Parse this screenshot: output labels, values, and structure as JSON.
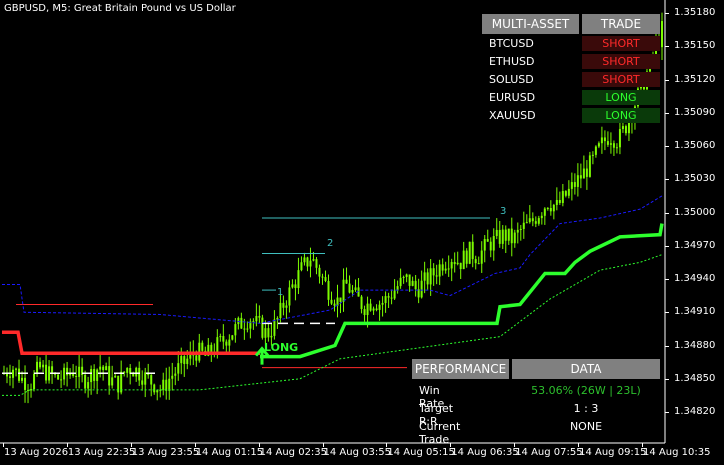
{
  "chart": {
    "title": "GBPUSD, M5:  Great Britain Pound vs US Dollar",
    "signal_label": "LONG",
    "tp_level_labels": [
      "1",
      "2",
      "3"
    ]
  },
  "chart_data": {
    "type": "candlestick",
    "symbol": "GBPUSD",
    "timeframe": "M5",
    "y_ticks": [
      "1.35180",
      "1.35150",
      "1.35120",
      "1.35090",
      "1.35060",
      "1.35030",
      "1.35000",
      "1.34970",
      "1.34940",
      "1.34910",
      "1.34880",
      "1.34850",
      "1.34820"
    ],
    "x_ticks": [
      "13 Aug 2026",
      "13 Aug 22:35",
      "13 Aug 23:55",
      "14 Aug 01:15",
      "14 Aug 02:35",
      "14 Aug 03:55",
      "14 Aug 05:15",
      "14 Aug 06:35",
      "14 Aug 07:55",
      "14 Aug 09:15",
      "14 Aug 10:35"
    ],
    "ylim": [
      1.348,
      1.3519
    ],
    "close_path": [
      1.34855,
      1.3486,
      1.3485,
      1.34845,
      1.3486,
      1.34855,
      1.3485,
      1.34852,
      1.34858,
      1.34848,
      1.34855,
      1.34862,
      1.3485,
      1.34845,
      1.3486,
      1.34858,
      1.34852,
      1.34846,
      1.3484,
      1.34852,
      1.3486,
      1.34868,
      1.34875,
      1.3487,
      1.34878,
      1.34885,
      1.34892,
      1.349,
      1.34905,
      1.34898,
      1.3489,
      1.349,
      1.3492,
      1.34935,
      1.3495,
      1.3496,
      1.34945,
      1.3493,
      1.3492,
      1.34935,
      1.34925,
      1.34915,
      1.3492,
      1.34918,
      1.34925,
      1.34935,
      1.3494,
      1.3493,
      1.34938,
      1.34945,
      1.34955,
      1.3496,
      1.34955,
      1.34965,
      1.3496,
      1.3497,
      1.34975,
      1.3498,
      1.34975,
      1.34985,
      1.3499,
      1.35,
      1.3501,
      1.35005,
      1.35015,
      1.35025,
      1.35035,
      1.35045,
      1.3506,
      1.3507,
      1.35065,
      1.3508,
      1.351,
      1.3512,
      1.3514,
      1.35165
    ],
    "indicator_levels": {
      "entry": 1.349,
      "stop": 1.34868,
      "tp1": 1.3493,
      "tp2": 1.34963,
      "tp3": 1.34995
    }
  },
  "multi_asset": {
    "header_left": "MULTI-ASSET",
    "header_right": "TRADE",
    "rows": [
      {
        "symbol": "BTCUSD",
        "signal": "SHORT"
      },
      {
        "symbol": "ETHUSD",
        "signal": "SHORT"
      },
      {
        "symbol": "SOLUSD",
        "signal": "SHORT"
      },
      {
        "symbol": "EURUSD",
        "signal": "LONG"
      },
      {
        "symbol": "XAUUSD",
        "signal": "LONG"
      }
    ]
  },
  "performance": {
    "header_left": "PERFORMANCE",
    "header_right": "DATA",
    "rows": [
      {
        "label": "Win Rate",
        "value": "53.06% (26W | 23L)"
      },
      {
        "label": "Target R:R",
        "value": "1 : 3"
      },
      {
        "label": "Current Trade",
        "value": "NONE"
      }
    ]
  },
  "colors": {
    "background": "#000000",
    "candles": "#7CFC00",
    "trail_main_bull": "#2dff2d",
    "trail_main_bear": "#ff2a2a",
    "tp_line": "#3fbfbf",
    "band": "#1a1aff",
    "win_rate_text": "#2dbf2d"
  }
}
